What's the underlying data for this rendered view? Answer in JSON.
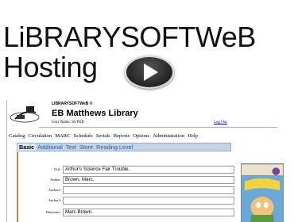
{
  "slide": {
    "title_line1": "LiBRARYSOFTWeB",
    "title_line2": "Hosting"
  },
  "app": {
    "brand": "LIBRARYSOFTWeB ®",
    "library_name": "EB Matthews Library",
    "user_label": "User Name: SUPER",
    "logout_label": "Log Out"
  },
  "menu": [
    "Catalog",
    "Circulation",
    "MARC",
    "Schedule",
    "Serials",
    "Reports",
    "Options",
    "Administration",
    "Help"
  ],
  "tabs": [
    "Basic",
    "Additional",
    "Text",
    "Store",
    "Reading Level"
  ],
  "form": [
    {
      "label": "Title",
      "value": "Arthur's Science Fair Trouble."
    },
    {
      "label": "Author",
      "value": "Brown, Marc."
    },
    {
      "label": "Author2",
      "value": ""
    },
    {
      "label": "Author3",
      "value": ""
    },
    {
      "label": "Illustrator",
      "value": "Marc Brown."
    }
  ],
  "colors": {
    "accent": "#1b5ea8",
    "tab_bar": "#c6d3e4"
  },
  "icons": {
    "play": "play-icon",
    "logo": "librarysoftweb-logo-icon"
  }
}
